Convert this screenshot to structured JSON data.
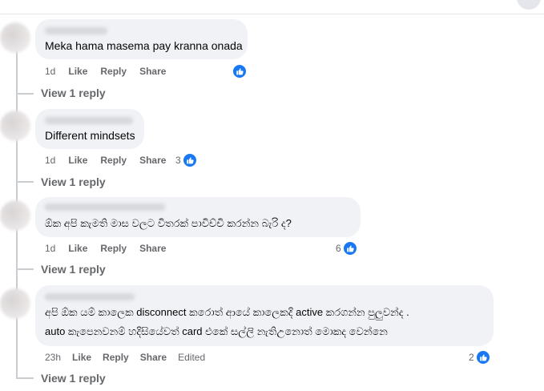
{
  "comments": [
    {
      "author": "Lakshmi Dilan",
      "text": "Meka hama masema pay kranna onada",
      "time": "1d",
      "like": "Like",
      "reply": "Reply",
      "share": "Share",
      "reaction_count": "",
      "view_replies": "View 1 reply"
    },
    {
      "author": "",
      "text": "Different mindsets",
      "time": "1d",
      "like": "Like",
      "reply": "Reply",
      "share": "Share",
      "reaction_count": "3",
      "view_replies": "View 1 reply"
    },
    {
      "author": "",
      "text": "ඕක අපි කැමති මාස වලට විතරක් පාවිච්චි කරන්න බැරි ද?",
      "time": "1d",
      "like": "Like",
      "reply": "Reply",
      "share": "Share",
      "reaction_count": "6",
      "view_replies": "View 1 reply"
    },
    {
      "author": "",
      "text_line1": "අපි ඕක යම් කාලෙක disconnect කරොත් ආයේ කාලෙකදි active කරගන්න පුලුවන්ද .",
      "text_line2": "auto කැපෙනවනම් හදිසියේවත් card එකේ සල්ලි නැතිඋනොත් මොකද වෙන්නෙ",
      "time": "23h",
      "like": "Like",
      "reply": "Reply",
      "share": "Share",
      "edited": "Edited",
      "reaction_count": "2",
      "view_replies": "View 1 reply"
    }
  ],
  "colors": {
    "bubble": "#f0f2f5",
    "meta_text": "#65676b",
    "like_blue": "#1877f2"
  }
}
